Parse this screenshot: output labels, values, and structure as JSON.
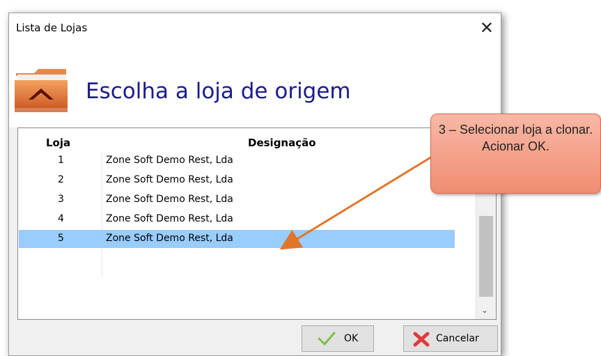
{
  "window": {
    "title": "Lista de Lojas",
    "close_symbol": "✕"
  },
  "header": {
    "title": "Escolha a loja de origem"
  },
  "table": {
    "columns": [
      "Loja",
      "Designação"
    ],
    "rows": [
      {
        "loja": "1",
        "designacao": "Zone Soft Demo Rest, Lda"
      },
      {
        "loja": "2",
        "designacao": "Zone Soft Demo Rest, Lda"
      },
      {
        "loja": "3",
        "designacao": "Zone Soft Demo Rest, Lda"
      },
      {
        "loja": "4",
        "designacao": "Zone Soft Demo Rest, Lda"
      },
      {
        "loja": "5",
        "designacao": "Zone Soft Demo Rest, Lda"
      }
    ],
    "selected_row": 5
  },
  "buttons": {
    "ok_label": "OK",
    "cancel_label": "Cancelar"
  },
  "callout": {
    "text": "3 – Selecionar loja a clonar. Acionar OK."
  },
  "colors": {
    "selection": "#99ccff",
    "title_blue": "#1b1b8f",
    "callout_fill": "#f4a48c",
    "arrow": "#e0762a"
  },
  "icons": {
    "header": "folder-home-icon",
    "ok": "check-icon",
    "cancel": "cross-icon",
    "close": "close-icon"
  }
}
